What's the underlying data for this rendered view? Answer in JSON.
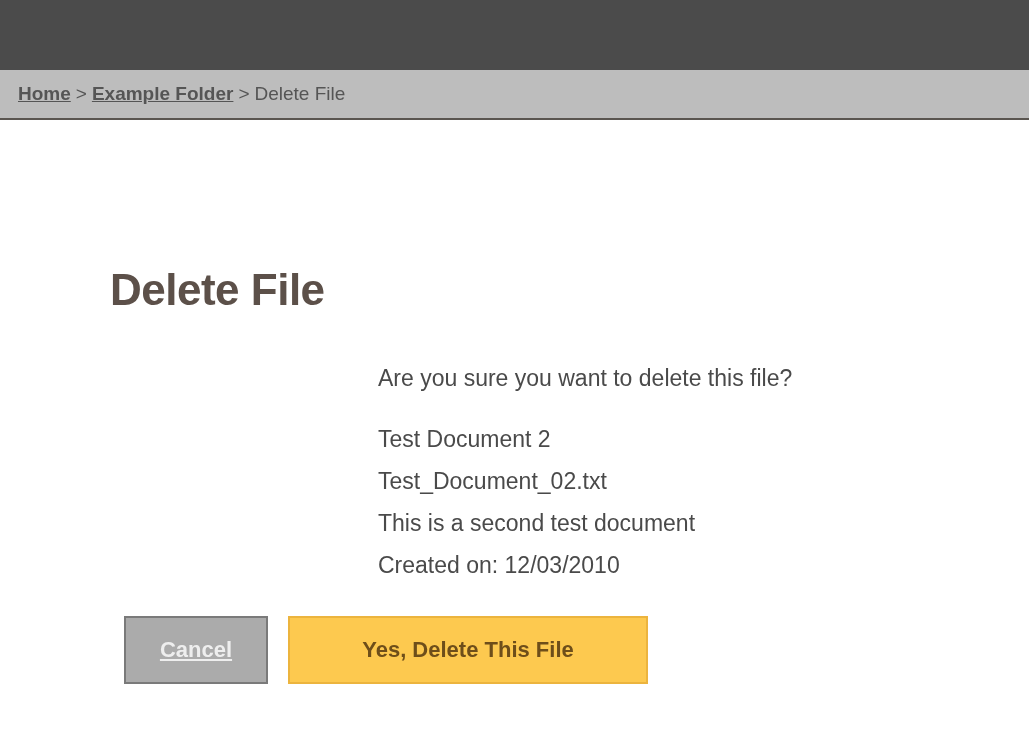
{
  "breadcrumb": [
    {
      "kind": "link",
      "label": "Home"
    },
    {
      "kind": "separator",
      "label": ">"
    },
    {
      "kind": "link",
      "label": "Example Folder"
    },
    {
      "kind": "separator",
      "label": ">"
    },
    {
      "kind": "current",
      "label": "Delete File"
    }
  ],
  "heading": "Delete File",
  "question": "Are you sure you want to delete this file?",
  "details": [
    "Test Document 2",
    "Test_Document_02.txt",
    "This is a second test document",
    "Created on: 12/03/2010"
  ],
  "buttons": [
    {
      "kind": "cancel",
      "label": "Cancel"
    },
    {
      "kind": "confirm",
      "label": "Yes, Delete This File"
    }
  ]
}
